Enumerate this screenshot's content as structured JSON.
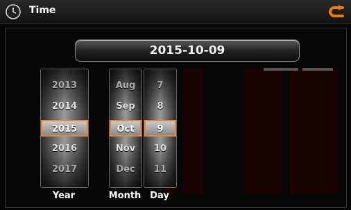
{
  "header": {
    "title": "Time"
  },
  "date_display": "2015-10-09",
  "year": {
    "label": "Year",
    "items": [
      "2013",
      "2014",
      "2015",
      "2016",
      "2017"
    ],
    "selected": "2015"
  },
  "month": {
    "label": "Month",
    "items": [
      "Aug",
      "Sep",
      "Oct",
      "Nov",
      "Dec"
    ],
    "selected": "Oct"
  },
  "day": {
    "label": "Day",
    "items": [
      "7",
      "8",
      "9",
      "10",
      "11"
    ],
    "selected": "9"
  },
  "colors": {
    "accent": "#e8853c",
    "background_panel": "#1b0303"
  }
}
